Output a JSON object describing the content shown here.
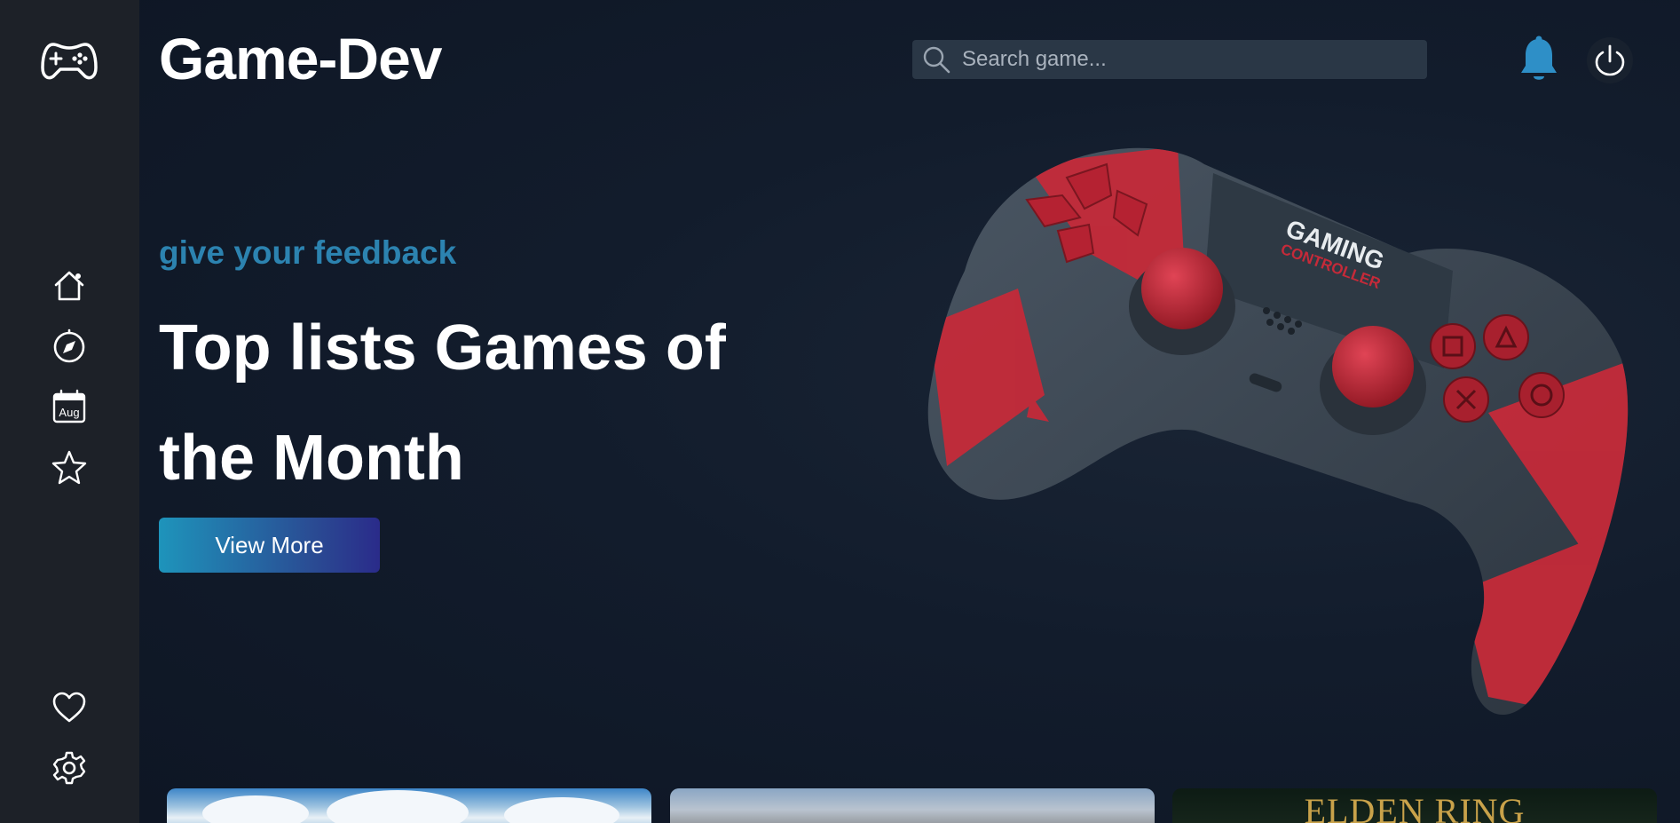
{
  "app": {
    "brand": "Game-Dev"
  },
  "sidebar": {
    "logo_icon": "gamepad-icon",
    "nav_items": [
      {
        "icon": "home-icon"
      },
      {
        "icon": "compass-icon"
      },
      {
        "icon": "calendar-icon",
        "label": "Aug"
      },
      {
        "icon": "star-icon"
      }
    ],
    "bottom_items": [
      {
        "icon": "heart-icon"
      },
      {
        "icon": "settings-gear-icon"
      }
    ]
  },
  "header": {
    "search": {
      "placeholder": "Search game..."
    },
    "icons": [
      "bell-icon",
      "power-icon"
    ]
  },
  "hero": {
    "eyebrow": "give your feedback",
    "headline": "Top lists Games of the Month",
    "cta_label": "View More",
    "controller_text": {
      "line1": "GAMING",
      "line2": "CONTROLLER"
    }
  },
  "cards": [
    {
      "title": ""
    },
    {
      "title": ""
    },
    {
      "title": "ELDEN RING"
    }
  ],
  "colors": {
    "background": "#0f1726",
    "sidebar": "#1d2128",
    "accent": "#2c83b0",
    "bell": "#2e8fc7",
    "controller_red": "#c52a39",
    "controller_body": "#3a4550"
  }
}
